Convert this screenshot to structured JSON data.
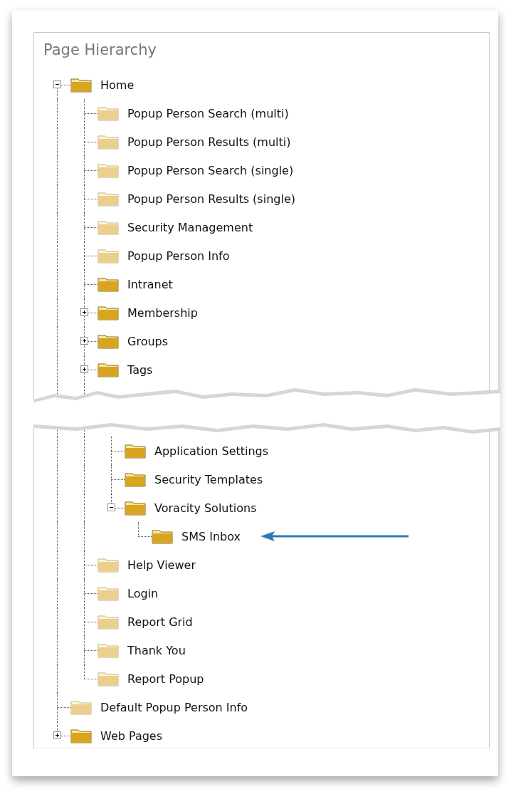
{
  "title": "Page Hierarchy",
  "tree": [
    {
      "label": "Home",
      "kind": "folder",
      "expanded": true,
      "children": [
        {
          "label": "Popup Person Search (multi)",
          "kind": "page"
        },
        {
          "label": "Popup Person Results (multi)",
          "kind": "page"
        },
        {
          "label": "Popup Person Search (single)",
          "kind": "page"
        },
        {
          "label": "Popup Person Results (single)",
          "kind": "page"
        },
        {
          "label": "Security Management",
          "kind": "page"
        },
        {
          "label": "Popup Person Info",
          "kind": "page"
        },
        {
          "label": "Intranet",
          "kind": "folder"
        },
        {
          "label": "Membership",
          "kind": "folder",
          "expanded": false
        },
        {
          "label": "Groups",
          "kind": "folder",
          "expanded": false
        },
        {
          "label": "Tags",
          "kind": "folder",
          "expanded": false
        },
        {
          "kind": "tear",
          "children": [
            {
              "label": "Application Settings",
              "kind": "folder"
            },
            {
              "label": "Security Templates",
              "kind": "folder"
            },
            {
              "label": "Voracity Solutions",
              "kind": "folder",
              "expanded": true,
              "children": [
                {
                  "label": "SMS Inbox",
                  "kind": "folder",
                  "annotated": true
                }
              ]
            }
          ]
        },
        {
          "label": "Help Viewer",
          "kind": "page"
        },
        {
          "label": "Login",
          "kind": "page"
        },
        {
          "label": "Report Grid",
          "kind": "page"
        },
        {
          "label": "Thank You",
          "kind": "page"
        },
        {
          "label": "Report Popup",
          "kind": "page"
        }
      ]
    },
    {
      "label": "Default Popup Person Info",
      "kind": "page"
    },
    {
      "label": "Web Pages",
      "kind": "folder",
      "expanded": false
    }
  ]
}
